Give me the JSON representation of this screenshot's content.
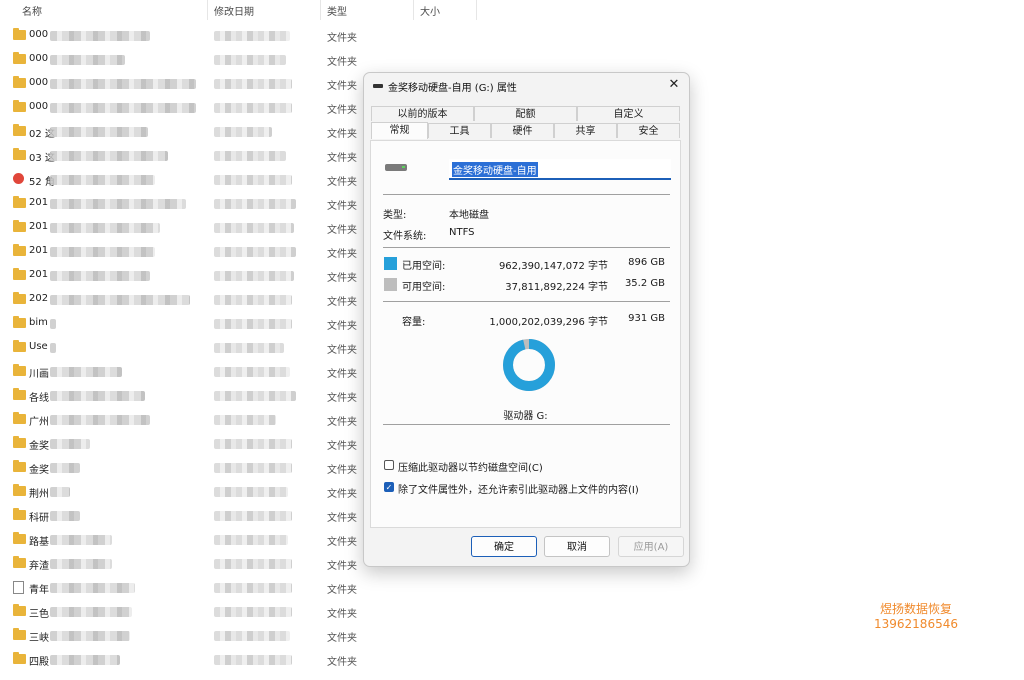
{
  "explorer": {
    "columns": {
      "name": "名称",
      "date": "修改日期",
      "type": "类型",
      "size": "大小"
    },
    "rows": [
      {
        "name": "000",
        "icon": "folder",
        "type": "文件夹"
      },
      {
        "name": "000",
        "icon": "folder",
        "type": "文件夹"
      },
      {
        "name": "000",
        "icon": "folder",
        "type": "文件夹"
      },
      {
        "name": "000",
        "icon": "folder",
        "type": "文件夹"
      },
      {
        "name": "02 这",
        "icon": "folder",
        "type": "文件夹"
      },
      {
        "name": "03 这",
        "icon": "folder",
        "type": "文件夹"
      },
      {
        "name": "52 角",
        "icon": "special",
        "type": "文件夹"
      },
      {
        "name": "201",
        "icon": "folder",
        "type": "文件夹"
      },
      {
        "name": "201",
        "icon": "folder",
        "type": "文件夹"
      },
      {
        "name": "201",
        "icon": "folder",
        "type": "文件夹"
      },
      {
        "name": "201",
        "icon": "folder",
        "type": "文件夹"
      },
      {
        "name": "202",
        "icon": "folder",
        "type": "文件夹"
      },
      {
        "name": "bim",
        "icon": "folder",
        "type": "文件夹"
      },
      {
        "name": "Use",
        "icon": "folder",
        "type": "文件夹"
      },
      {
        "name": "川画",
        "icon": "folder",
        "type": "文件夹"
      },
      {
        "name": "各线",
        "icon": "folder",
        "type": "文件夹"
      },
      {
        "name": "广州",
        "icon": "folder",
        "type": "文件夹"
      },
      {
        "name": "金奖",
        "icon": "folder",
        "type": "文件夹"
      },
      {
        "name": "金奖",
        "icon": "folder",
        "type": "文件夹"
      },
      {
        "name": "荆州",
        "icon": "folder",
        "type": "文件夹"
      },
      {
        "name": "科研",
        "icon": "folder",
        "type": "文件夹"
      },
      {
        "name": "路基",
        "icon": "folder",
        "type": "文件夹"
      },
      {
        "name": "弃渣",
        "icon": "folder",
        "type": "文件夹"
      },
      {
        "name": "青年",
        "icon": "file",
        "type": "文件夹"
      },
      {
        "name": "三色",
        "icon": "folder",
        "type": "文件夹"
      },
      {
        "name": "三峡",
        "icon": "folder",
        "type": "文件夹"
      },
      {
        "name": "四殿",
        "icon": "folder",
        "type": "文件夹"
      }
    ]
  },
  "dialog": {
    "title": "金奖移动硬盘-自用 (G:) 属性",
    "close_label": "✕",
    "tabs_row1": [
      "以前的版本",
      "配额",
      "自定义"
    ],
    "tabs_row2": [
      "常规",
      "工具",
      "硬件",
      "共享",
      "安全"
    ],
    "drive_name": "金奖移动硬盘-自用",
    "type_label": "类型:",
    "type_value": "本地磁盘",
    "fs_label": "文件系统:",
    "fs_value": "NTFS",
    "used_label": "已用空间:",
    "used_bytes": "962,390,147,072 字节",
    "used_size": "896 GB",
    "free_label": "可用空间:",
    "free_bytes": "37,811,892,224 字节",
    "free_size": "35.2 GB",
    "capacity_label": "容量:",
    "capacity_bytes": "1,000,202,039,296 字节",
    "capacity_size": "931 GB",
    "used_fraction": 0.962,
    "used_color": "#26a0da",
    "free_color": "#bdbdbd",
    "drive_caption": "驱动器 G:",
    "compress_label": "压缩此驱动器以节约磁盘空间(C)",
    "compress_checked": false,
    "index_label": "除了文件属性外，还允许索引此驱动器上文件的内容(I)",
    "index_checked": true,
    "ok_label": "确定",
    "cancel_label": "取消",
    "apply_label": "应用(A)"
  },
  "watermark": {
    "line1": "煜扬数据恢复",
    "line2": "13962186546"
  }
}
